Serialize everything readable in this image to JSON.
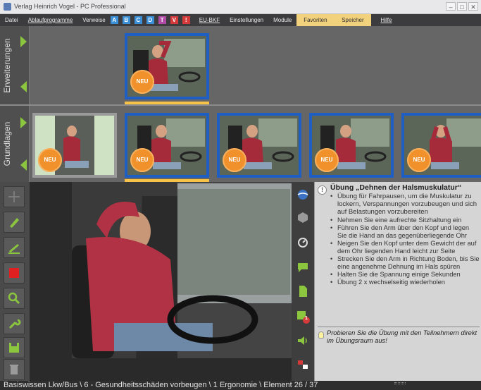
{
  "window": {
    "title": "Verlag Heinrich Vogel - PC Professional",
    "controls": [
      "–",
      "□",
      "✕"
    ]
  },
  "menu": {
    "datei": "Datei",
    "ablaufprogramme": "Ablaufprogramme",
    "verweise": "Verweise",
    "letters": [
      {
        "label": "A",
        "color": "#3a8fd6"
      },
      {
        "label": "B",
        "color": "#3a8fd6"
      },
      {
        "label": "C",
        "color": "#3a8fd6"
      },
      {
        "label": "D",
        "color": "#3a8fd6"
      },
      {
        "label": "T",
        "color": "#b04aa6"
      },
      {
        "label": "V",
        "color": "#d43a3a"
      },
      {
        "label": "!",
        "color": "#d43a3a"
      }
    ],
    "eu_bkf": "EU-BKF",
    "einstellungen": "Einstellungen",
    "module": "Module",
    "favoriten": "Favoriten",
    "speicher": "Speicher",
    "hilfe": "Hilfe"
  },
  "rows": {
    "erweiterungen": "Erweiterungen",
    "grundlagen": "Grundlagen"
  },
  "badge": "NEU",
  "exercise": {
    "title": "Übung „Dehnen der Halsmuskulatur“",
    "intro": "Übung für Fahrpausen, um die Muskulatur zu lockern, Verspannungen vorzubeugen und sich auf Belastungen vorzubereiten",
    "steps": [
      "Nehmen Sie eine aufrechte Sitzhaltung ein",
      "Führen Sie den Arm über den Kopf und legen Sie die Hand an das gegenüberliegende Ohr",
      "Neigen Sie den Kopf unter dem Gewicht der auf dem Ohr liegenden Hand leicht zur Seite",
      "Strecken Sie den Arm in Richtung Boden, bis Sie eine angenehme Dehnung im Hals spüren",
      "Halten Sie die Spannung einige Sekunden",
      "Übung 2 x wechselseitig wiederholen"
    ],
    "tip": "Probieren Sie die Übung mit den Teilnehmern direkt im Übungsraum aus!",
    "info_glyph": "!"
  },
  "notification_count": "1",
  "statusbar": "Basiswissen Lkw/Bus \\ 6 - Gesundheitsschäden vorbeugen \\ 1 Ergonomie  \\ Element 26 / 37",
  "colors": {
    "accent_green": "#8cc63f",
    "thumb_border": "#1f5fc4",
    "selection": "#f6c247",
    "badge": "#f0912b"
  }
}
